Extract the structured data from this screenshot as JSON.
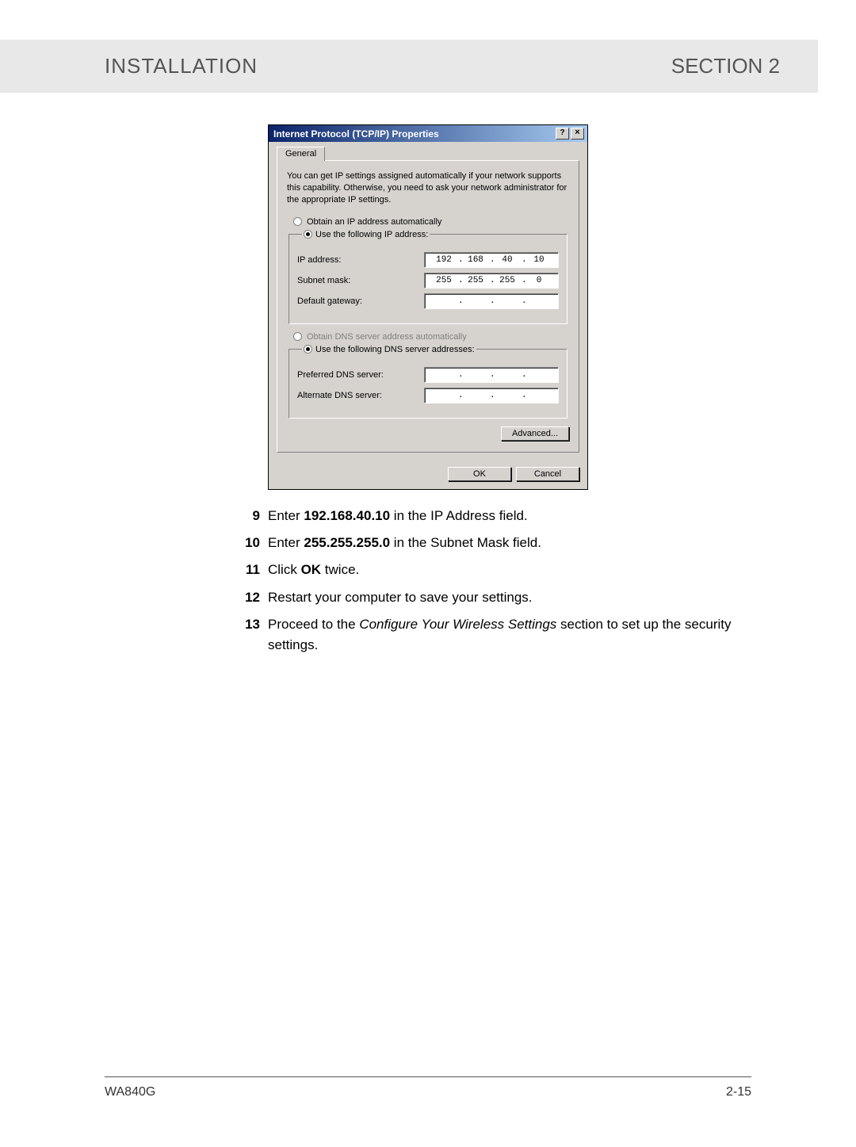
{
  "header": {
    "left": "INSTALLATION",
    "right": "SECTION 2"
  },
  "dialog": {
    "title": "Internet Protocol (TCP/IP) Properties",
    "help_btn": "?",
    "close_btn": "×",
    "tab": "General",
    "desc": "You can get IP settings assigned automatically if your network supports this capability. Otherwise, you need to ask your network administrator for the appropriate IP settings.",
    "radio_auto_ip": "Obtain an IP address automatically",
    "radio_manual_ip": "Use the following IP address:",
    "labels": {
      "ip": "IP address:",
      "subnet": "Subnet mask:",
      "gateway": "Default gateway:",
      "pref_dns": "Preferred DNS server:",
      "alt_dns": "Alternate DNS server:"
    },
    "ip": {
      "o1": "192",
      "o2": "168",
      "o3": "40",
      "o4": "10"
    },
    "subnet": {
      "o1": "255",
      "o2": "255",
      "o3": "255",
      "o4": "0"
    },
    "gateway": {
      "o1": "",
      "o2": "",
      "o3": "",
      "o4": ""
    },
    "radio_auto_dns": "Obtain DNS server address automatically",
    "radio_manual_dns": "Use the following DNS server addresses:",
    "pref_dns": {
      "o1": "",
      "o2": "",
      "o3": "",
      "o4": ""
    },
    "alt_dns": {
      "o1": "",
      "o2": "",
      "o3": "",
      "o4": ""
    },
    "advanced": "Advanced...",
    "ok": "OK",
    "cancel": "Cancel"
  },
  "steps": {
    "s9": {
      "n": "9",
      "pre": "Enter ",
      "b": "192.168.40.10",
      "post": " in the IP Address field."
    },
    "s10": {
      "n": "10",
      "pre": "Enter ",
      "b": "255.255.255.0",
      "post": " in the Subnet Mask field."
    },
    "s11": {
      "n": "11",
      "pre": "Click ",
      "b": "OK",
      "post": " twice."
    },
    "s12": {
      "n": "12",
      "t": "Restart your computer to save your settings."
    },
    "s13": {
      "n": "13",
      "pre": "Proceed to the ",
      "i": "Configure Your Wireless Settings",
      "post": " section to set up the security settings."
    }
  },
  "footer": {
    "model": "WA840G",
    "page": "2-15"
  }
}
